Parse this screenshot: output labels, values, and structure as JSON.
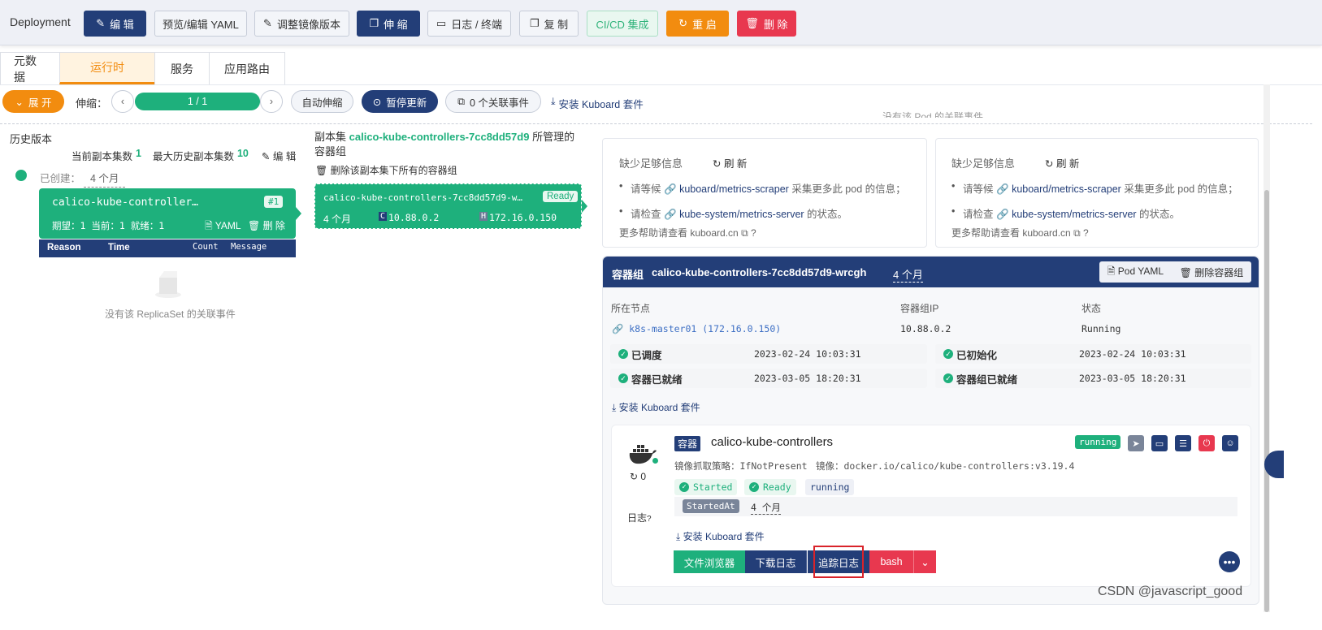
{
  "toolbar": {
    "title": "Deployment",
    "edit": "编 辑",
    "preview_yaml": "预览/编辑 YAML",
    "adjust_image": "调整镜像版本",
    "scale": "伸 缩",
    "logs_terminal": "日志 / 终端",
    "copy": "复 制",
    "cicd": "CI/CD 集成",
    "restart": "重 启",
    "delete": "删 除"
  },
  "tabs": [
    "元数据",
    "运行时",
    "服务",
    "应用路由"
  ],
  "controls": {
    "expand": "展 开",
    "scale_label": "伸缩：",
    "replicas": "1 / 1",
    "replica_progress": 1.0,
    "auto_scale": "自动伸缩",
    "pause_update": "暂停更新",
    "related_events": "0 个关联事件",
    "install_kuboard": "安装 Kuboard 套件"
  },
  "history": {
    "title": "历史版本",
    "current_replicas_label": "当前副本集数",
    "current_replicas": "1",
    "max_history_label": "最大历史副本集数",
    "max_history": "10",
    "edit": "编 辑",
    "created_label": "已创建：",
    "created_value": "4 个月",
    "rs_name": "calico-kube-controller…",
    "rs_badge": "#1",
    "rs_stats": "期望：1 当前：1 就绪：1",
    "rs_yaml": "YAML",
    "rs_delete": "删 除",
    "event_headers": [
      "Reason",
      "Time",
      "Count",
      "Message"
    ],
    "no_events": "没有该 ReplicaSet 的关联事件"
  },
  "replicaset": {
    "title_prefix": "副本集",
    "title_name": "calico-kube-controllers-7cc8dd57d9",
    "title_suffix": "所管理的",
    "title_line2": "容器组",
    "delete_all": "删除该副本集下所有的容器组",
    "pod_name": "calico-kube-controllers-7cc8dd57d9-w…",
    "pod_status": "Ready",
    "pod_age": "4 个月",
    "pod_c_label": "C",
    "pod_ip": "10.88.0.2",
    "pod_h_label": "H",
    "host_ip": "172.16.0.150"
  },
  "metrics_cards": [
    {
      "title": "缺少足够信息",
      "refresh": "刷 新",
      "line1_prefix": "请等候",
      "line1_link": "kuboard/metrics-scraper",
      "line1_suffix": "采集更多此 pod 的信息；",
      "line2_prefix": "请检查",
      "line2_link": "kube-system/metrics-server",
      "line2_suffix": "的状态。",
      "help": "更多帮助请查看 kuboard.cn"
    },
    {
      "title": "缺少足够信息",
      "refresh": "刷 新",
      "line1_prefix": "请等候",
      "line1_link": "kuboard/metrics-scraper",
      "line1_suffix": "采集更多此 pod 的信息；",
      "line2_prefix": "请检查",
      "line2_link": "kube-system/metrics-server",
      "line2_suffix": "的状态。",
      "help": "更多帮助请查看 kuboard.cn"
    }
  ],
  "truncated_text": "没有该 Pod 的关联事件",
  "pod": {
    "header_label": "容器组",
    "name": "calico-kube-controllers-7cc8dd57d9-wrcgh",
    "age": "4 个月",
    "yaml_btn": "Pod YAML",
    "delete_btn": "删除容器组",
    "node_label": "所在节点",
    "ip_label": "容器组IP",
    "status_label": "状态",
    "node_value": "k8s-master01 (172.16.0.150)",
    "ip_value": "10.88.0.2",
    "status_value": "Running",
    "conditions": [
      {
        "label": "已调度",
        "time": "2023-02-24 10:03:31"
      },
      {
        "label": "已初始化",
        "time": "2023-02-24 10:03:31"
      },
      {
        "label": "容器已就绪",
        "time": "2023-03-05 18:20:31"
      },
      {
        "label": "容器组已就绪",
        "time": "2023-03-05 18:20:31"
      }
    ],
    "install_kuboard": "安装 Kuboard 套件"
  },
  "container": {
    "tag": "容器",
    "name": "calico-kube-controllers",
    "state_badge": "running",
    "restarts": "0",
    "pull_policy": "镜像抓取策略：IfNotPresent",
    "image": "镜像：docker.io/calico/kube-controllers:v3.19.4",
    "tags": [
      "Started",
      "Ready",
      "running"
    ],
    "started_at_label": "StartedAt",
    "started_at_value": "4 个月",
    "log_label": "日志",
    "install_kuboard": "安装 Kuboard 套件",
    "actions": {
      "file_browser": "文件浏览器",
      "download_log": "下载日志",
      "trace_log": "追踪日志",
      "bash": "bash"
    }
  },
  "watermark": "CSDN @javascript_good",
  "colors": {
    "navy": "#233e78",
    "green": "#1eb07c",
    "orange": "#f28c0f",
    "red": "#e8384f"
  }
}
